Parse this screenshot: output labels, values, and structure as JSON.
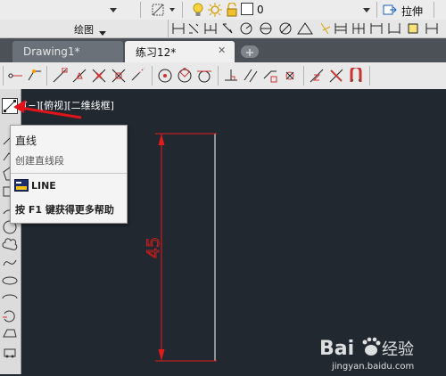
{
  "ribbon": {
    "stretch_label": "拉伸",
    "layer_value": "0"
  },
  "panel": {
    "label": "绘图"
  },
  "tabs": [
    {
      "label": "Drawing1*",
      "active": false
    },
    {
      "label": "练习12*",
      "active": true
    }
  ],
  "viewport": {
    "label": "[−][俯视][二维线框]"
  },
  "tooltip": {
    "title": "直线",
    "description": "创建直线段",
    "command": "LINE",
    "help": "按 F1 键获得更多帮助"
  },
  "dimension": {
    "value": "45"
  },
  "watermark": {
    "brand": "Bai",
    "brand_suffix": "经验",
    "url": "jingyan.baidu.com"
  },
  "colors": {
    "dimension": "#e01b1b",
    "line": "#ffffff",
    "canvas": "#212830"
  }
}
